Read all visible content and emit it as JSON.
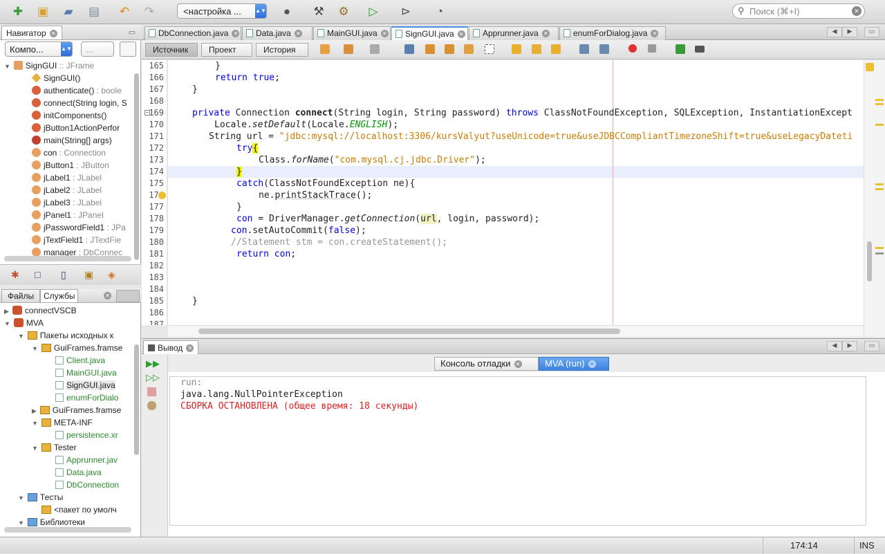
{
  "toolbar": {
    "config": "<настройка ...",
    "search_placeholder": "Поиск (⌘+I)"
  },
  "navigator": {
    "tab_label": "Навигатор",
    "combo": "Компо...",
    "combo2": "...",
    "root": "SignGUI",
    "root_type": ":: JFrame",
    "items": [
      {
        "name": "SignGUI()",
        "type": "",
        "kind": "ctor"
      },
      {
        "name": "authenticate()",
        "type": ": boole",
        "kind": "method"
      },
      {
        "name": "connect(String login, S",
        "type": "",
        "kind": "method"
      },
      {
        "name": "initComponents()",
        "type": "",
        "kind": "method"
      },
      {
        "name": "jButton1ActionPerfor",
        "type": "",
        "kind": "method"
      },
      {
        "name": "main(String[] args)",
        "type": "",
        "kind": "static"
      },
      {
        "name": "con",
        "type": ": Connection",
        "kind": "field"
      },
      {
        "name": "jButton1",
        "type": ": JButton",
        "kind": "field"
      },
      {
        "name": "jLabel1",
        "type": ": JLabel",
        "kind": "field"
      },
      {
        "name": "jLabel2",
        "type": ": JLabel",
        "kind": "field"
      },
      {
        "name": "jLabel3",
        "type": ": JLabel",
        "kind": "field"
      },
      {
        "name": "jPanel1",
        "type": ": JPanel",
        "kind": "field"
      },
      {
        "name": "jPasswordField1",
        "type": ": JPa",
        "kind": "field"
      },
      {
        "name": "jTextField1",
        "type": ": JTextFie",
        "kind": "field"
      },
      {
        "name": "manager",
        "type": ": DbConnec",
        "kind": "field"
      }
    ]
  },
  "files": {
    "tab_files": "Файлы",
    "tab_services": "Службы",
    "tree": [
      {
        "label": "connectVSCB",
        "level": 0,
        "icon": "project",
        "open": false
      },
      {
        "label": "MVA",
        "level": 0,
        "icon": "project",
        "open": true
      },
      {
        "label": "Пакеты исходных к",
        "level": 1,
        "icon": "package",
        "open": true
      },
      {
        "label": "GuiFrames.framse",
        "level": 2,
        "icon": "package",
        "open": true
      },
      {
        "label": "Client.java",
        "level": 3,
        "icon": "file",
        "open": null
      },
      {
        "label": "MainGUI.java",
        "level": 3,
        "icon": "file",
        "open": null
      },
      {
        "label": "SignGUI.java",
        "level": 3,
        "icon": "file",
        "open": null
      },
      {
        "label": "enumForDialo",
        "level": 3,
        "icon": "file",
        "open": null
      },
      {
        "label": "GuiFrames.framse",
        "level": 2,
        "icon": "package",
        "open": false
      },
      {
        "label": "META-INF",
        "level": 2,
        "icon": "package",
        "open": true
      },
      {
        "label": "persistence.xr",
        "level": 3,
        "icon": "file",
        "open": null
      },
      {
        "label": "Tester",
        "level": 2,
        "icon": "package",
        "open": true
      },
      {
        "label": "Apprunner.jav",
        "level": 3,
        "icon": "file",
        "open": null
      },
      {
        "label": "Data.java",
        "level": 3,
        "icon": "file",
        "open": null
      },
      {
        "label": "DbConnection",
        "level": 3,
        "icon": "file",
        "open": null
      },
      {
        "label": "Тесты",
        "level": 1,
        "icon": "folder",
        "open": true
      },
      {
        "label": "<пакет по умолч",
        "level": 2,
        "icon": "package",
        "open": null
      },
      {
        "label": "Библиотеки",
        "level": 1,
        "icon": "folder",
        "open": true
      }
    ]
  },
  "editor": {
    "tabs": [
      "DbConnection.java",
      "Data.java",
      "MainGUI.java",
      "SignGUI.java",
      "Apprunner.java",
      "enumForDialog.java"
    ],
    "active_tab": "SignGUI.java",
    "view_source": "Источник",
    "view_project": "Проект",
    "view_history": "История",
    "line_numbers": [
      "165",
      "166",
      "167",
      "168",
      "169",
      "170",
      "171",
      "172",
      "173",
      "174",
      "175",
      "176",
      "177",
      "178",
      "179",
      "180",
      "181",
      "182",
      "183",
      "184",
      "185",
      "186",
      "187"
    ]
  },
  "output": {
    "tab_label": "Вывод",
    "subtab_debug": "Консоль отладки",
    "subtab_run": "MVA (run)",
    "lines": [
      {
        "text": "run:",
        "color": "#888888"
      },
      {
        "text": "java.lang.NullPointerException",
        "color": "#222222"
      },
      {
        "text": "СБОРКА ОСТАНОВЛЕНА (общее время: 18 секунды)",
        "color": "#e02020"
      }
    ]
  },
  "status": {
    "position": "174:14",
    "mode": "INS"
  }
}
